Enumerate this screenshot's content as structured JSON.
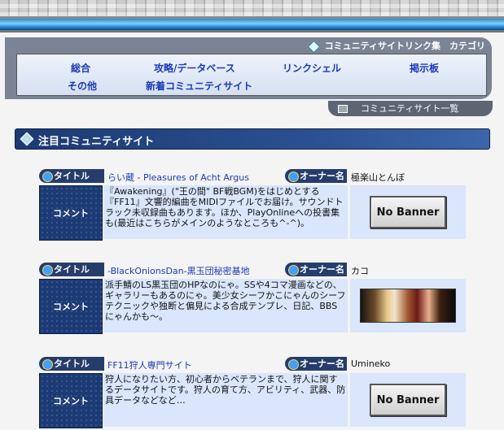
{
  "nav": {
    "title": "コミュニティサイトリンク集　カテゴリ",
    "categories": [
      "総合",
      "攻略/データベース",
      "リンクシェル",
      "掲示板",
      "その他",
      "新着コミュニティサイト"
    ],
    "list_button": "コミュニティサイト一覧"
  },
  "section": {
    "title": "注目コミュニティサイト",
    "labels": {
      "title": "タイトル",
      "owner": "オーナー名",
      "comment": "コメント"
    }
  },
  "entries": [
    {
      "title": "らい蔵 - Pleasures of Acht Argus",
      "owner": "極楽山とんぼ",
      "comment": "『Awakening』(\"王の間\" BF戦BGM)をはじめとする『FF11』文響的編曲をMIDIファイルでお届け。サウンドトラック未収録曲もあります。ほか、PlayOnlineへの投書集も(最近はこちらがメインのようなところも^-^)。",
      "banner": "No Banner"
    },
    {
      "title": "-BlackOnionsDan-黒玉団秘密基地",
      "owner": "カコ",
      "comment": "派手鯖のLS黒玉団のHPなのにゃ。SSや4コマ漫画などの、ギャラリーもあるのにゃ。美少女シーフかこにゃんのシーフテクニックや独断と偏見による合成テンプレ、日記、BBSにゃんかも～。",
      "banner": ""
    },
    {
      "title": "FF11狩人専門サイト",
      "owner": "Umineko",
      "comment": "狩人になりたい方、初心者からベテランまで、狩人に関するデータサイトです。狩人の育て方、アビリティ、武器、防具データなどなど…",
      "banner": "No Banner"
    }
  ]
}
